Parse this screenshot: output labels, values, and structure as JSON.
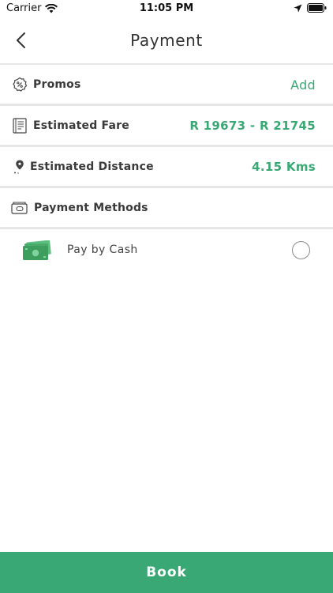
{
  "status_bar": {
    "carrier": "Carrier",
    "time": "11:05 PM"
  },
  "header": {
    "title": "Payment"
  },
  "rows": {
    "promos": {
      "label": "Promos",
      "action": "Add"
    },
    "fare": {
      "label": "Estimated Fare",
      "value": "R 19673 - R 21745"
    },
    "distance": {
      "label": "Estimated Distance",
      "value": "4.15 Kms"
    },
    "methods": {
      "label": "Payment Methods"
    }
  },
  "payment_options": [
    {
      "label": "Pay by Cash",
      "icon": "cash-icon",
      "selected": false
    }
  ],
  "footer": {
    "button_label": "Book"
  },
  "colors": {
    "accent": "#3aa874",
    "divider": "#e6e6e6",
    "text": "#333333"
  }
}
